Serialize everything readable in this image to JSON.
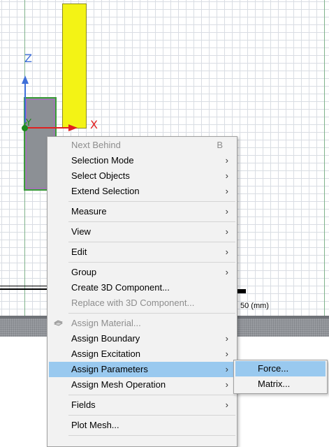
{
  "viewport": {
    "axes": {
      "z_label": "Z",
      "x_label": "X",
      "y_label": "Y"
    },
    "scale_label": "50 (mm)",
    "colors": {
      "object_yellow": "#f3f315",
      "object_gray": "#8c9095",
      "axis_x": "#e02020",
      "axis_z": "#3f6fd8",
      "axis_y": "#1d8a1d"
    }
  },
  "context_menu": {
    "items": [
      {
        "label": "Next Behind",
        "shortcut": "B",
        "disabled": true
      },
      {
        "label": "Selection Mode",
        "has_submenu": true
      },
      {
        "label": "Select Objects",
        "has_submenu": true
      },
      {
        "label": "Extend Selection",
        "has_submenu": true
      },
      {
        "label": "Measure",
        "has_submenu": true
      },
      {
        "label": "View",
        "has_submenu": true
      },
      {
        "label": "Edit",
        "has_submenu": true
      },
      {
        "label": "Group",
        "has_submenu": true
      },
      {
        "label": "Create 3D Component..."
      },
      {
        "label": "Replace with 3D Component...",
        "disabled": true
      },
      {
        "label": "Assign Material...",
        "disabled": true,
        "icon": "material-icon"
      },
      {
        "label": "Assign Boundary",
        "has_submenu": true
      },
      {
        "label": "Assign Excitation",
        "has_submenu": true
      },
      {
        "label": "Assign Parameters",
        "has_submenu": true,
        "highlighted": true
      },
      {
        "label": "Assign Mesh Operation",
        "has_submenu": true
      },
      {
        "label": "Fields",
        "has_submenu": true
      },
      {
        "label": "Plot Mesh..."
      }
    ],
    "submenu_arrow": "›",
    "highlight_color": "#99c9ef"
  },
  "submenu": {
    "items": [
      {
        "label": "Force...",
        "highlighted": true
      },
      {
        "label": "Matrix..."
      }
    ]
  }
}
